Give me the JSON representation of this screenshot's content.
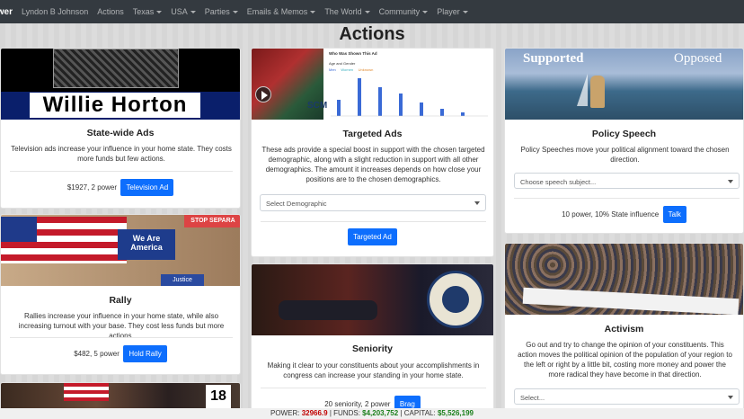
{
  "navbar": {
    "brand": "wer",
    "items": [
      {
        "label": "Lyndon B Johnson",
        "dropdown": false
      },
      {
        "label": "Actions",
        "dropdown": false
      },
      {
        "label": "Texas",
        "dropdown": true
      },
      {
        "label": "USA",
        "dropdown": true
      },
      {
        "label": "Parties",
        "dropdown": true
      },
      {
        "label": "Emails & Memos",
        "dropdown": true
      },
      {
        "label": "The World",
        "dropdown": true
      },
      {
        "label": "Community",
        "dropdown": true
      },
      {
        "label": "Player",
        "dropdown": true
      }
    ]
  },
  "page": {
    "title": "Actions"
  },
  "cards": {
    "statewide": {
      "image_caption": "Willie Horton",
      "title": "State-wide Ads",
      "text": "Television ads increase your influence in your home state. They costs more funds but few actions.",
      "cost": "$1927, 2 power",
      "button": "Television Ad"
    },
    "targeted": {
      "image_chart_title": "Who Was Shown This Ad",
      "image_chart_sub": "Age and Gender",
      "image_legend": [
        "Men",
        "Women",
        "Unknown"
      ],
      "title": "Targeted Ads",
      "text": "These ads provide a special boost in support with the chosen targeted demographic, along with a slight reduction in support with all other demographics. The amount it increases depends on how close your positions are to the chosen demographics.",
      "select_placeholder": "Select Demographic",
      "button": "Targeted Ad"
    },
    "policy": {
      "image_left": "Supported",
      "image_right": "Opposed",
      "title": "Policy Speech",
      "text": "Policy Speeches move your political alignment toward the chosen direction.",
      "select_placeholder": "Choose speech subject...",
      "cost": "10 power, 10% State influence",
      "button": "Talk"
    },
    "rally": {
      "image_signs": [
        "We Are America",
        "STOP SEPARA",
        "Justice"
      ],
      "title": "Rally",
      "text": "Rallies increase your influence in your home state, while also increasing turnout with your base. They cost less funds but more actions.",
      "cost": "$482, 5 power",
      "button": "Hold Rally"
    },
    "seniority": {
      "title": "Seniority",
      "text": "Making it clear to your constituents about your accomplishments in congress can increase your standing in your home state.",
      "cost": "20 seniority, 2 power",
      "button": "Brag"
    },
    "activism": {
      "title": "Activism",
      "text": "Go out and try to change the opinion of your constituents. This action moves the political opinion of the population of your region to the left or right by a little bit, costing more money and power the more radical they have become in that direction.",
      "select_placeholder": "Select..."
    },
    "bottom_left": {
      "image_number": "18"
    }
  },
  "status": {
    "power_label": "POWER:",
    "power": "32966.9",
    "funds_label": "FUNDS:",
    "funds": "$4,203,752",
    "capital_label": "CAPITAL:",
    "capital": "$5,526,199"
  },
  "colors": {
    "navbar": "#343a40",
    "button": "#0d6efd"
  }
}
